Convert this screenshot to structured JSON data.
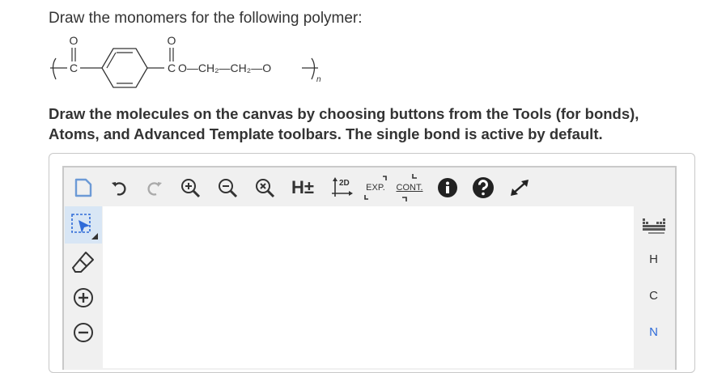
{
  "question": {
    "prompt": "Draw the monomers for the following polymer:"
  },
  "polymer": {
    "o_top_left": "O",
    "o_top_right": "O",
    "c_left": "C",
    "c_right": "C",
    "chain": "O—CH₂—CH₂—O",
    "repeat_subscript": "n"
  },
  "instructions": {
    "text": "Draw the molecules on the canvas by choosing buttons from the Tools (for bonds), Atoms, and Advanced Template toolbars. The single bond is active by default."
  },
  "toolbar": {
    "hydrogens_label": "H±",
    "clean2d_label": "2D",
    "expand_label": "EXP.",
    "contract_label": "CONT."
  },
  "atoms": {
    "items": [
      "H",
      "C",
      "N"
    ]
  },
  "colors": {
    "accent": "#2f6bd8",
    "active_tool_bg": "#d8e6f5"
  }
}
